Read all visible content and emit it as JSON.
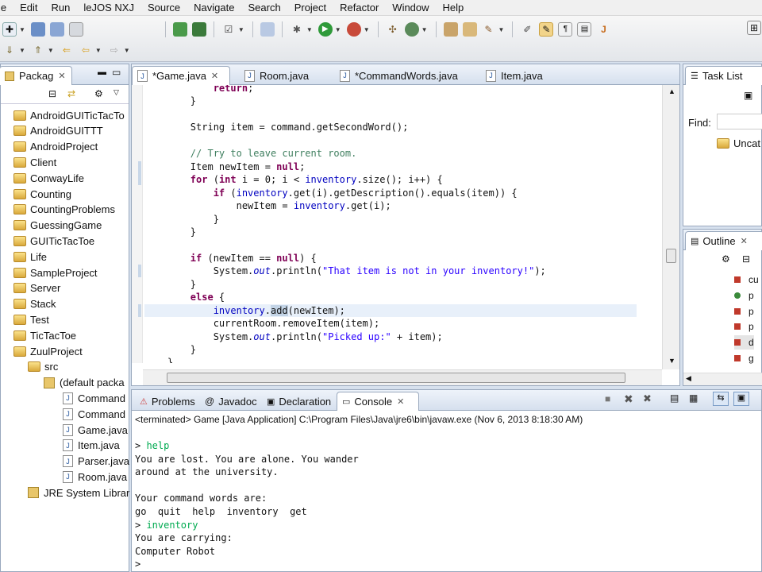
{
  "menu": [
    "le",
    "Edit",
    "Run",
    "leJOS NXJ",
    "Source",
    "Navigate",
    "Search",
    "Project",
    "Refactor",
    "Window",
    "Help"
  ],
  "package_explorer": {
    "title": "Packag",
    "projects": [
      "AndroidGUITicTacTo",
      "AndroidGUITTT",
      "AndroidProject",
      "Client",
      "ConwayLife",
      "Counting",
      "CountingProblems",
      "GuessingGame",
      "GUITicTacToe",
      "Life",
      "SampleProject",
      "Server",
      "Stack",
      "Test",
      "TicTacToe",
      "ZuulProject"
    ],
    "src": "src",
    "default_package": "(default packa",
    "files": [
      "Command",
      "Command",
      "Game.java",
      "Item.java",
      "Parser.java",
      "Room.java"
    ],
    "jre": "JRE System Librar"
  },
  "editor": {
    "tabs": [
      "*Game.java",
      "Room.java",
      "*CommandWords.java",
      "Item.java"
    ],
    "active_tab": "*Game.java",
    "code": [
      "            return;",
      "        }",
      "",
      "        String item = command.getSecondWord();",
      "",
      "        // Try to leave current room.",
      "        Item newItem = null;",
      "        for (int i = 0; i < inventory.size(); i++) {",
      "            if (inventory.get(i).getDescription().equals(item)) {",
      "                newItem = inventory.get(i);",
      "            }",
      "        }",
      "",
      "        if (newItem == null) {",
      "            System.out.println(\"That item is not in your inventory!\");",
      "        }",
      "        else {",
      "            inventory.add(newItem);",
      "            currentRoom.removeItem(item);",
      "            System.out.println(\"Picked up:\" + item);",
      "        }",
      "    }"
    ]
  },
  "task_list": {
    "title": "Task List",
    "find_label": "Find:",
    "category": "Uncat"
  },
  "outline": {
    "title": "Outline",
    "items": [
      "cu",
      "p",
      "p",
      "p",
      "d",
      "g"
    ]
  },
  "bottom_tabs": [
    "Problems",
    "Javadoc",
    "Declaration",
    "Console"
  ],
  "console": {
    "status": "<terminated> Game [Java Application] C:\\Program Files\\Java\\jre6\\bin\\javaw.exe (Nov 6, 2013 8:18:30 AM)",
    "lines": [
      {
        "text": "> help",
        "input": true
      },
      {
        "text": "You are lost. You are alone. You wander",
        "input": false
      },
      {
        "text": "around at the university.",
        "input": false
      },
      {
        "text": "",
        "input": false
      },
      {
        "text": "Your command words are:",
        "input": false
      },
      {
        "text": "go  quit  help  inventory  get",
        "input": false
      },
      {
        "text": "> inventory",
        "input": true
      },
      {
        "text": "You are carrying:",
        "input": false
      },
      {
        "text": "Computer Robot",
        "input": false
      },
      {
        "text": ">",
        "input": false
      }
    ]
  },
  "colors": {
    "keyword": "#7f0055",
    "string": "#2a00ff",
    "comment": "#3f7f5f",
    "field": "#0000c0",
    "console_input": "#00aa50"
  }
}
